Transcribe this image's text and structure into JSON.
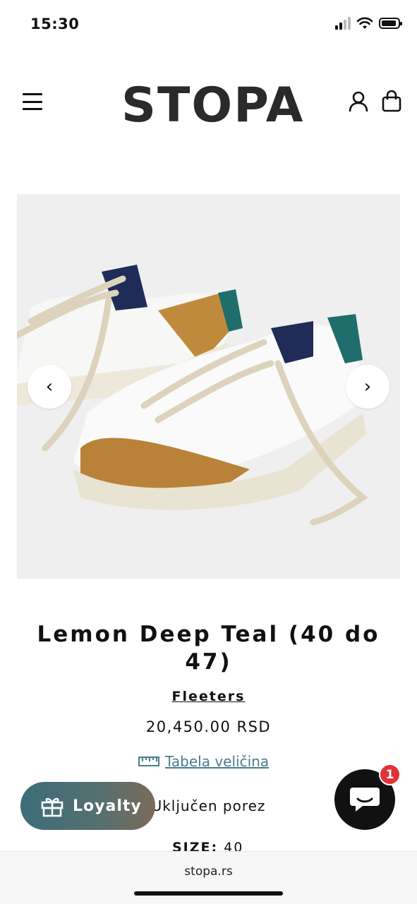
{
  "status_bar": {
    "time": "15:30"
  },
  "header": {
    "logo": "STOPA",
    "menu_icon": "hamburger-icon",
    "account_icon": "user-icon",
    "cart_icon": "bag-icon"
  },
  "product": {
    "image_alt": "Lemon Deep Teal sneakers",
    "prev_arrow": "‹",
    "next_arrow": "›",
    "title": "Lemon Deep Teal (40 do 47)",
    "vendor": "Fleeters",
    "price": "20,450.00 RSD",
    "size_chart_label": "Tabela veličina",
    "tax_note": "Uključen porez",
    "size_label": "SIZE:",
    "size_value": "40"
  },
  "loyalty": {
    "label": "Loyalty"
  },
  "chat": {
    "badge_count": "1"
  },
  "browser": {
    "url": "stopa.rs"
  },
  "colors": {
    "accent_link": "#4a7d8c",
    "badge_red": "#e0323a",
    "text": "#111111"
  }
}
